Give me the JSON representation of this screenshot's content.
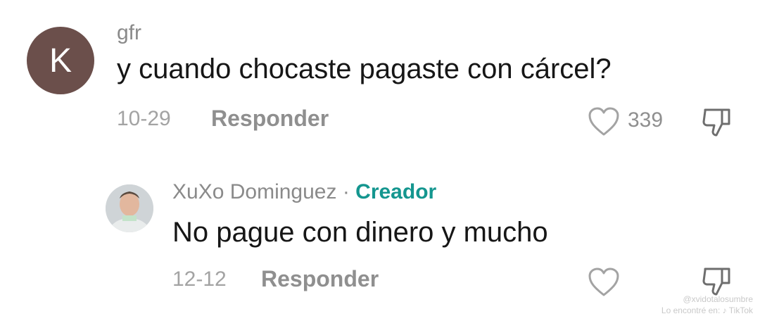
{
  "comments": [
    {
      "avatar_letter": "K",
      "avatar_color": "#6b4f4b",
      "username": "gfr",
      "text": "y cuando chocaste pagaste con cárcel?",
      "date": "10-29",
      "reply_label": "Responder",
      "likes": "339",
      "icons": [
        "heart-icon",
        "dislike-icon"
      ]
    },
    {
      "avatar_type": "photo",
      "username": "XuXo Dominguez",
      "separator": "·",
      "badge": "Creador",
      "badge_color": "#14968f",
      "text": "No pague con dinero y mucho",
      "date": "12-12",
      "reply_label": "Responder",
      "icons": [
        "heart-icon",
        "dislike-icon"
      ]
    }
  ],
  "watermark": {
    "line1": "@xvidotalosumbre",
    "line2": "Lo encontré en: ♪ TikTok"
  }
}
